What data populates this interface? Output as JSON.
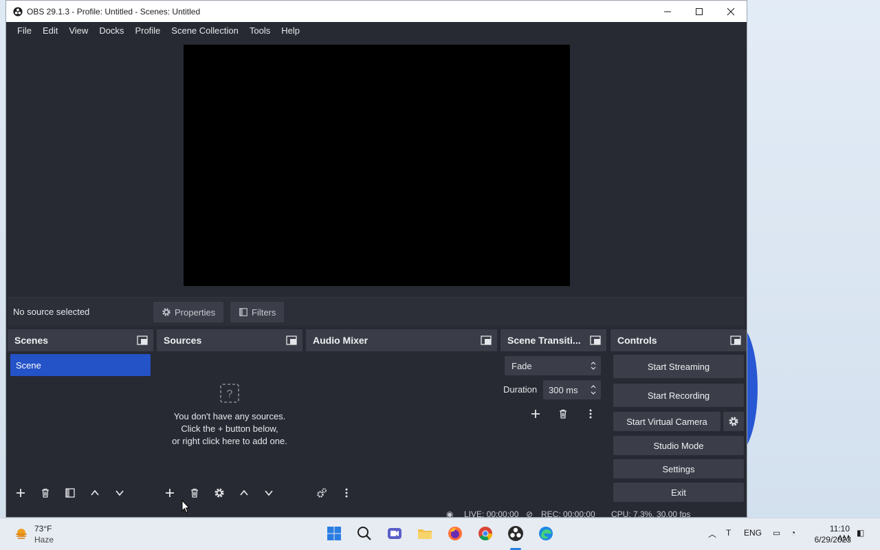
{
  "window": {
    "title": "OBS 29.1.3 - Profile: Untitled - Scenes: Untitled"
  },
  "menu": [
    "File",
    "Edit",
    "View",
    "Docks",
    "Profile",
    "Scene Collection",
    "Tools",
    "Help"
  ],
  "source_bar": {
    "status": "No source selected",
    "properties_label": "Properties",
    "filters_label": "Filters"
  },
  "docks": {
    "scenes": {
      "title": "Scenes",
      "items": [
        "Scene"
      ]
    },
    "sources": {
      "title": "Sources",
      "empty_line1": "You don't have any sources.",
      "empty_line2": "Click the + button below,",
      "empty_line3": "or right click here to add one."
    },
    "audio": {
      "title": "Audio Mixer"
    },
    "transitions": {
      "title": "Scene Transiti...",
      "selected": "Fade",
      "duration_label": "Duration",
      "duration_value": "300 ms"
    },
    "controls": {
      "title": "Controls",
      "start_streaming": "Start Streaming",
      "start_recording": "Start Recording",
      "start_virtual_camera": "Start Virtual Camera",
      "studio_mode": "Studio Mode",
      "settings": "Settings",
      "exit": "Exit"
    }
  },
  "status": {
    "live": "LIVE: 00:00:00",
    "rec": "REC: 00:00:00",
    "cpu": "CPU: 7.3%, 30.00 fps"
  },
  "taskbar": {
    "temp": "73°F",
    "condition": "Haze",
    "lang": "ENG",
    "time": "11:10 AM",
    "date": "6/29/2023"
  },
  "colors": {
    "obs_bg": "#272a33",
    "dock_header": "#3a3d47",
    "accent_blue": "#2452c7"
  }
}
